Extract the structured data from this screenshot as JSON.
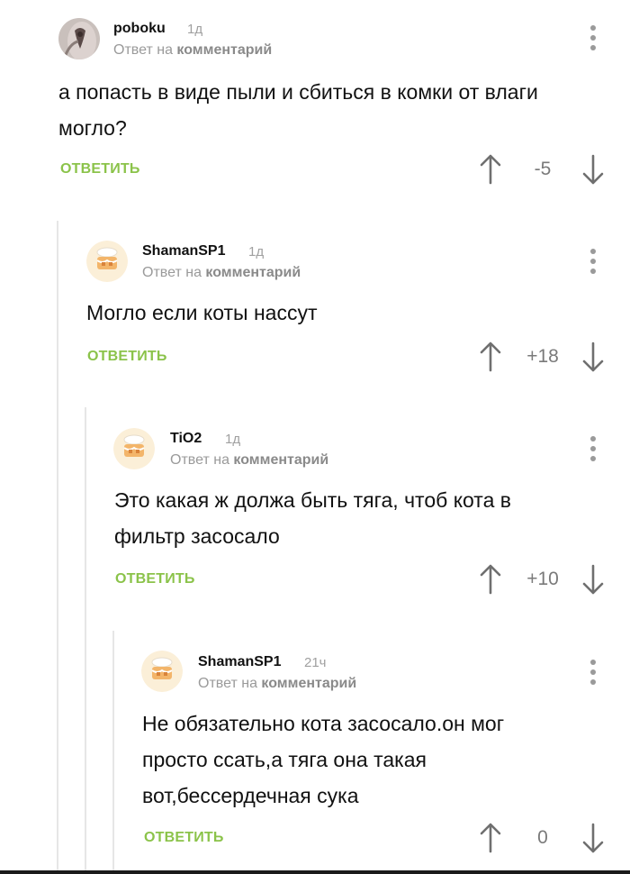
{
  "comments": [
    {
      "username": "poboku",
      "time": "1д",
      "reply_prefix": "Ответ на",
      "reply_target": "комментарий",
      "text": "а попасть в виде пыли и сбиться в комки от влаги могло?",
      "reply_label": "ОТВЕТИТЬ",
      "score": "-5",
      "avatar_icon": "photo-avatar"
    },
    {
      "username": "ShamanSP1",
      "time": "1д",
      "reply_prefix": "Ответ на",
      "reply_target": "комментарий",
      "text": "Могло если коты нассут",
      "reply_label": "ОТВЕТИТЬ",
      "score": "+18",
      "avatar_icon": "cake-avatar"
    },
    {
      "username": "TiO2",
      "time": "1д",
      "reply_prefix": "Ответ на",
      "reply_target": "комментарий",
      "text": "Это какая ж должа быть тяга, чтоб кота в фильтр засосало",
      "reply_label": "ОТВЕТИТЬ",
      "score": "+10",
      "avatar_icon": "cake-avatar"
    },
    {
      "username": "ShamanSP1",
      "time": "21ч",
      "reply_prefix": "Ответ на",
      "reply_target": "комментарий",
      "text": "Не обязательно кота засосало.он мог просто ссать,а тяга она такая вот,бессердечная сука",
      "reply_label": "ОТВЕТИТЬ",
      "score": "0",
      "avatar_icon": "cake-avatar"
    }
  ],
  "colors": {
    "accent": "#8bc34a",
    "muted": "#9a9a9a",
    "thread_line": "#e6e6e6"
  }
}
